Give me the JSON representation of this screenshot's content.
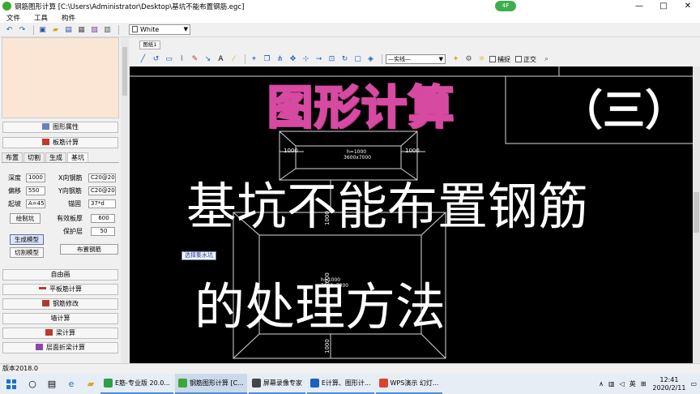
{
  "window": {
    "title": "钢筋图形计算 [C:\\Users\\Administrator\\Desktop\\基坑不能布置钢筋.egc]",
    "badge": "4F",
    "controls": [
      "—",
      "□",
      "✕"
    ]
  },
  "menu": [
    "文件",
    "工具",
    "构件"
  ],
  "toolbar": {
    "color_value": "White"
  },
  "left_panel": {
    "buttons_top": [
      {
        "label": "图形属性"
      },
      {
        "label": "板筋计算"
      }
    ],
    "tabs": [
      {
        "label": "布置",
        "active": false
      },
      {
        "label": "切割",
        "active": false
      },
      {
        "label": "生成",
        "active": false
      },
      {
        "label": "基坑",
        "active": true
      }
    ],
    "fields": {
      "depth_label": "深度",
      "depth_value": "1000",
      "offset_label": "偏移",
      "offset_value": "550",
      "slope_label": "起坡",
      "slope_value": "A=45",
      "horiz_bar_label": "X向钢筋",
      "horiz_bar_value": "C20@200",
      "vert_bar_label": "Y向钢筋",
      "vert_bar_value": "C20@200",
      "anchor_label": "锚固",
      "anchor_value": "37*d",
      "eff_height_label": "有效板厚",
      "eff_height_value": "600",
      "cover_label": "保护层",
      "cover_value": "50"
    },
    "draw_pit_button": "绘制坑",
    "gen_model_button": "生成模型",
    "cut_model_button": "切割模型",
    "place_rebar_button": "布置钢筋",
    "buttons_bottom": [
      {
        "label": "自由画"
      },
      {
        "label": "平板筋计算"
      },
      {
        "label": "钢筋修改"
      },
      {
        "label": "墙计算"
      },
      {
        "label": "梁计算"
      },
      {
        "label": "层面折梁计算"
      }
    ]
  },
  "drawing": {
    "doc_tab": "图纸1",
    "line_type_value": "—实线—",
    "snap_label": "捕捉",
    "ortho_label": "正交",
    "overlay_title_1": "图形计算",
    "overlay_title_2": "（三）",
    "overlay_title_3": "基坑不能布置钢筋",
    "overlay_title_4": "的处理方法",
    "select_tag": "选择集水坑",
    "dims": {
      "top_left": "1000",
      "top_right": "1000",
      "center_top_a": "h=1000",
      "center_top_b": "3600x7000",
      "side_mid": "1000",
      "side_left": "3600",
      "center_mid_a": "h=1000",
      "center_mid_b": "3600x7000",
      "bottom_side": "1000"
    }
  },
  "status": {
    "version": "版本2018.0"
  },
  "taskbar": {
    "apps": [
      {
        "label": "E筋-专业版 20.0...",
        "color": "#2f9e44"
      },
      {
        "label": "钢筋图形计算 [C...",
        "color": "#3aa835",
        "active": true
      },
      {
        "label": "屏幕录像专家",
        "color": "#444444"
      },
      {
        "label": "E计算、图形计...",
        "color": "#1f5fbf"
      },
      {
        "label": "WPS演示 幻灯...",
        "color": "#d9462b"
      }
    ],
    "tray_ime": "英",
    "clock_time": "12:41",
    "clock_date": "2020/2/11"
  }
}
